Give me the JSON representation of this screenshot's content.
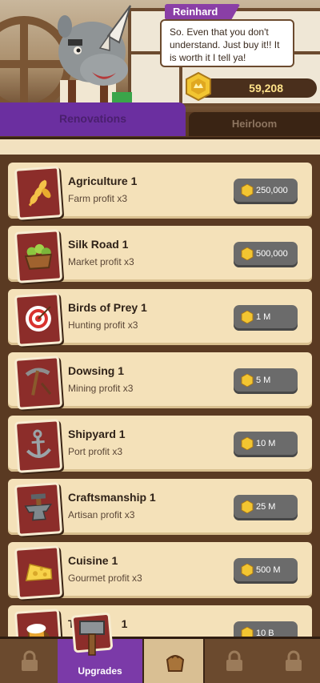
{
  "dialog": {
    "speaker": "Reinhard",
    "text": "So. Even that you don't understand. Just buy it!! It is worth it I tell ya!"
  },
  "currency": {
    "amount": "59,208",
    "icon": "gold-coin-icon"
  },
  "tabs": [
    {
      "label": "Renovations",
      "active": true
    },
    {
      "label": "Heirloom",
      "active": false
    }
  ],
  "upgrades": [
    {
      "name": "Agriculture 1",
      "desc": "Farm profit x3",
      "price": "250,000",
      "icon": "wheat-icon"
    },
    {
      "name": "Silk Road 1",
      "desc": "Market profit x3",
      "price": "500,000",
      "icon": "produce-basket-icon"
    },
    {
      "name": "Birds of Prey 1",
      "desc": "Hunting profit x3",
      "price": "1 M",
      "icon": "target-icon"
    },
    {
      "name": "Dowsing 1",
      "desc": "Mining profit x3",
      "price": "5 M",
      "icon": "pickaxe-icon"
    },
    {
      "name": "Shipyard 1",
      "desc": "Port profit x3",
      "price": "10 M",
      "icon": "anchor-icon"
    },
    {
      "name": "Craftsmanship 1",
      "desc": "Artisan profit x3",
      "price": "25 M",
      "icon": "anvil-icon"
    },
    {
      "name": "Cuisine 1",
      "desc": "Gourmet profit x3",
      "price": "500 M",
      "icon": "cheese-icon"
    },
    {
      "name": "T",
      "name_tail": "1",
      "desc": "",
      "price": "10 B",
      "icon": "tavern-icon"
    }
  ],
  "nav": [
    {
      "label": "",
      "icon": "lock-icon",
      "state": "locked"
    },
    {
      "label": "Upgrades",
      "icon": "hammer-icon",
      "state": "active"
    },
    {
      "label": "",
      "icon": "bag-icon",
      "state": "shop"
    },
    {
      "label": "",
      "icon": "lock-icon",
      "state": "locked"
    },
    {
      "label": "",
      "icon": "lock-icon",
      "state": "locked"
    }
  ],
  "colors": {
    "accent_purple": "#7b3aa8",
    "wood_brown": "#5a3a22",
    "card_cream": "#f4e1b9",
    "coin_gold": "#f2c531",
    "icon_card_red": "#8c2d2a"
  }
}
